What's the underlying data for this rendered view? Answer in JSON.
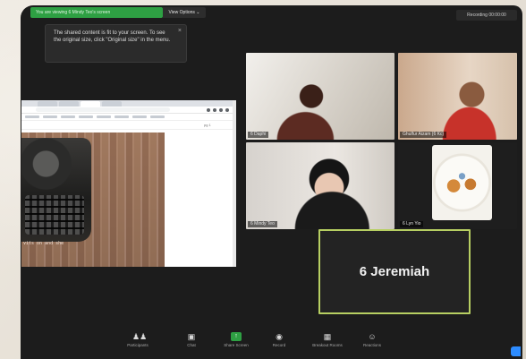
{
  "topbar": {
    "share_notice": "You are viewing 6 Mindy Teo's screen",
    "view_options": "View Options ⌄",
    "recording": "Recording  00:00:00"
  },
  "tooltip": {
    "text": "The shared content is fit to your screen. To see the original size, click \"Original size\" in the menu.",
    "close": "×"
  },
  "shared_screen": {
    "page_indicator": "pg 1",
    "caption": "vits on and she"
  },
  "participants": [
    {
      "name": "6 Daphi"
    },
    {
      "name": "Ghulfur Aizam (6 Kc)"
    },
    {
      "name": "6 Mindy Teo"
    },
    {
      "name": "6 Lyn Yio"
    }
  ],
  "active_speaker": {
    "name": "6 Jeremiah"
  },
  "toolbar": {
    "participants_label": "Participants",
    "participants_count": "6",
    "chat_label": "Chat",
    "share_label": "Share Screen",
    "record_label": "Record",
    "breakout_label": "Breakout Rooms",
    "reactions_label": "Reactions"
  },
  "colors": {
    "share_green": "#2ea043",
    "speaker_border": "#b7cf62",
    "app_bg": "#1c1c1c"
  }
}
